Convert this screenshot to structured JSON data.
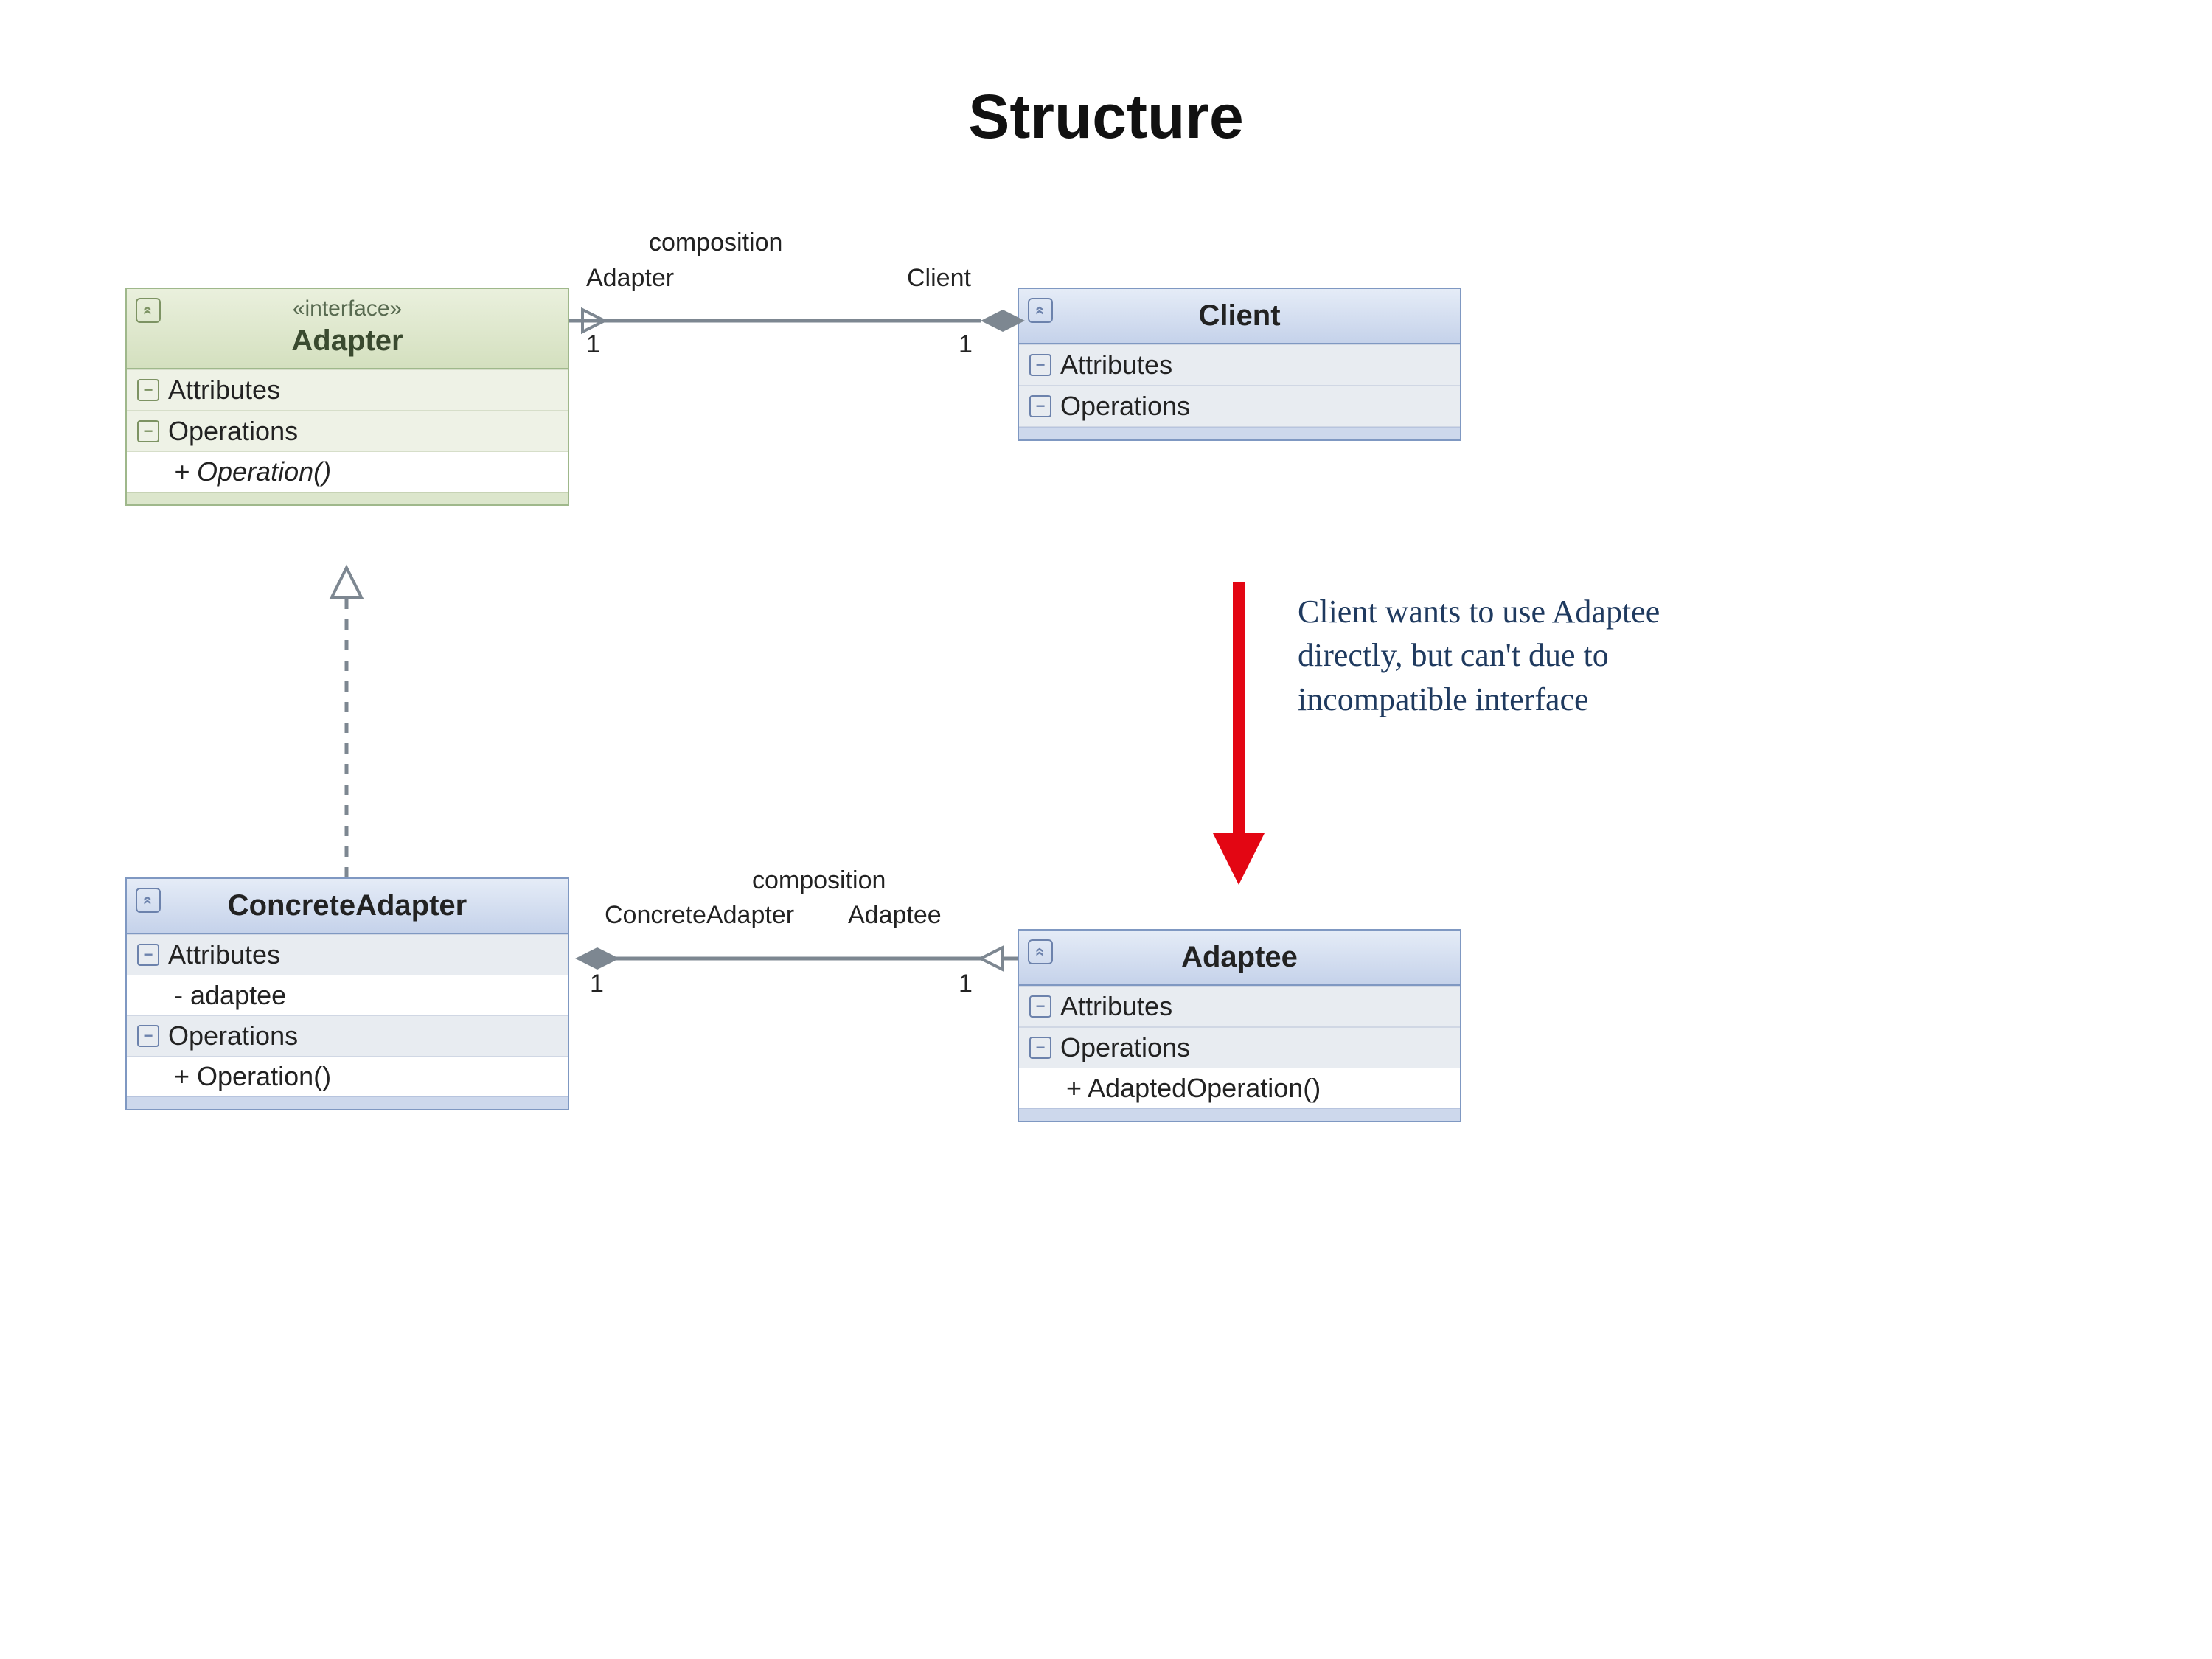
{
  "title": "Structure",
  "classes": {
    "adapter": {
      "stereotype": "«interface»",
      "name": "Adapter",
      "attr_label": "Attributes",
      "ops_label": "Operations",
      "op1": "+ Operation()"
    },
    "client": {
      "name": "Client",
      "attr_label": "Attributes",
      "ops_label": "Operations"
    },
    "concrete": {
      "name": "ConcreteAdapter",
      "attr_label": "Attributes",
      "attr1": "- adaptee",
      "ops_label": "Operations",
      "op1": "+ Operation()"
    },
    "adaptee": {
      "name": "Adaptee",
      "attr_label": "Attributes",
      "ops_label": "Operations",
      "op1": "+ AdaptedOperation()"
    }
  },
  "conn1": {
    "label": "composition",
    "roleA": "Adapter",
    "roleB": "Client",
    "multA": "1",
    "multB": "1"
  },
  "conn2": {
    "label": "composition",
    "roleA": "ConcreteAdapter",
    "roleB": "Adaptee",
    "multA": "1",
    "multB": "1"
  },
  "annotation": "Client wants to use Adaptee directly, but can't due to incompatible interface"
}
